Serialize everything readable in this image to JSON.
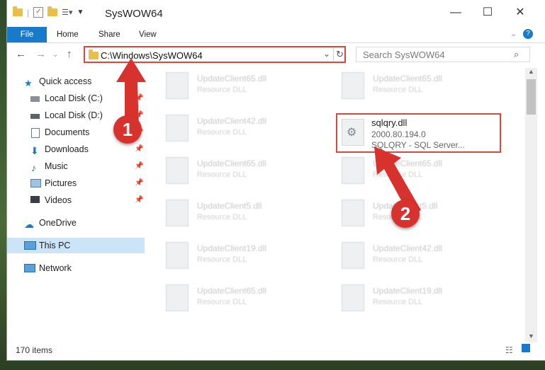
{
  "window": {
    "title": "SysWOW64",
    "minimize": "—",
    "maximize": "☐",
    "close": "✕"
  },
  "ribbon": {
    "tabs": [
      "File",
      "Home",
      "Share",
      "View"
    ]
  },
  "address": {
    "path": "C:\\Windows\\SysWOW64",
    "search_placeholder": "Search SysWOW64"
  },
  "sidebar": {
    "quick_access": "Quick access",
    "items": [
      "Local Disk (C:)",
      "Local Disk (D:)",
      "Documents",
      "Downloads",
      "Music",
      "Pictures",
      "Videos"
    ],
    "onedrive": "OneDrive",
    "thispc": "This PC",
    "network": "Network"
  },
  "files": [
    {
      "name": "UpdateClient65.dll",
      "type": "Resource DLL"
    },
    {
      "name": "UpdateClient65.dll",
      "type": "Resource DLL"
    },
    {
      "name": "UpdateClient42.dll",
      "type": "Resource DLL"
    },
    {
      "name": "UpdateClient65.dll",
      "type": "Resource DLL"
    },
    {
      "name": "UpdateClient65.dll",
      "type": "Resource DLL"
    },
    {
      "name": "UpdateClient5.dll",
      "type": "Resource DLL"
    },
    {
      "name": "UpdateClient5.dll",
      "type": "Resource DLL"
    },
    {
      "name": "UpdateClient19.dll",
      "type": "Resource DLL"
    },
    {
      "name": "UpdateClient42.dll",
      "type": "Resource DLL"
    },
    {
      "name": "UpdateClient65.dll",
      "type": "Resource DLL"
    },
    {
      "name": "UpdateClient19.dll",
      "type": "Resource DLL"
    }
  ],
  "highlighted_file": {
    "name": "sqlqry.dll",
    "version": "2000.80.194.0",
    "description": "SQLQRY - SQL Server..."
  },
  "status": {
    "count": "170 items"
  },
  "markers": {
    "one": "1",
    "two": "2"
  },
  "colors": {
    "accent": "#1979ca",
    "highlight": "#d9473f",
    "marker": "#d8322f"
  }
}
